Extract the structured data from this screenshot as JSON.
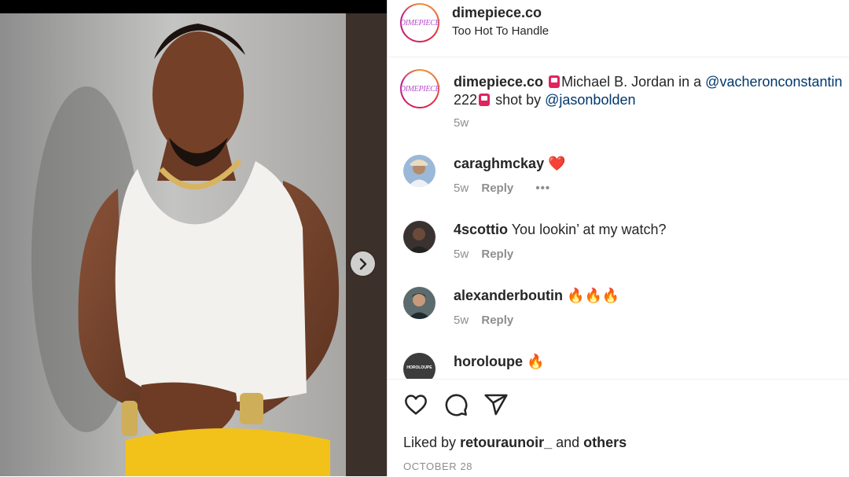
{
  "photo": {
    "alt": "Man in white tank top and yellow pants"
  },
  "post": {
    "username": "dimepiece.co",
    "subtitle": "Too Hot To Handle",
    "avatar_text": "DIMEPIECE"
  },
  "caption": {
    "username": "dimepiece.co",
    "text_1": "Michael B. Jordan in a",
    "mention_1": "@vacheronconstantin",
    "text_2": "222",
    "text_3": "shot by",
    "mention_2": "@jasonbolden",
    "time": "5w"
  },
  "comments": [
    {
      "username": "caraghmckay",
      "text": "",
      "emoji": "❤️",
      "time": "5w",
      "reply": "Reply",
      "more": "•••"
    },
    {
      "username": "4scottio",
      "text": "You lookin’ at my watch?",
      "emoji": "",
      "time": "5w",
      "reply": "Reply"
    },
    {
      "username": "alexanderboutin",
      "text": "",
      "emoji": "🔥🔥🔥",
      "time": "5w",
      "reply": "Reply"
    },
    {
      "username": "horoloupe",
      "text": "",
      "emoji": "🔥",
      "avatar_text": "HOROLOUPE"
    }
  ],
  "likes": {
    "prefix": "Liked by",
    "user": "retouraunoir_",
    "middle": "and",
    "others": "others"
  },
  "date": "OCTOBER 28",
  "icons": [
    "heart-icon",
    "comment-icon",
    "share-icon",
    "chevron-right-icon"
  ],
  "colors": {
    "mention": "#00376b",
    "muted": "#8e8e8e",
    "text": "#262626"
  }
}
